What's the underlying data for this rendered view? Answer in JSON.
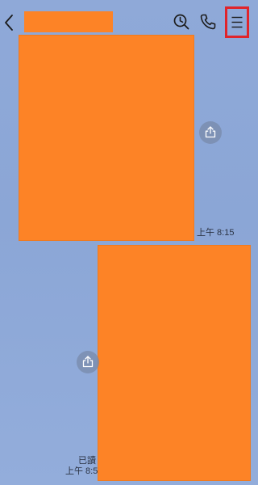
{
  "header": {
    "back_icon": "chevron-left-icon",
    "search_icon": "clock-search-icon",
    "call_icon": "phone-icon",
    "menu_icon": "hamburger-menu-icon",
    "highlight_color": "#e0242b",
    "redaction_color": "#fd8326"
  },
  "messages": [
    {
      "type": "image",
      "side": "incoming",
      "time": "上午 8:15",
      "share_icon": "share-icon"
    },
    {
      "type": "image",
      "side": "outgoing",
      "read_label": "已讀",
      "time": "上午 8:5",
      "share_icon": "share-icon"
    }
  ]
}
